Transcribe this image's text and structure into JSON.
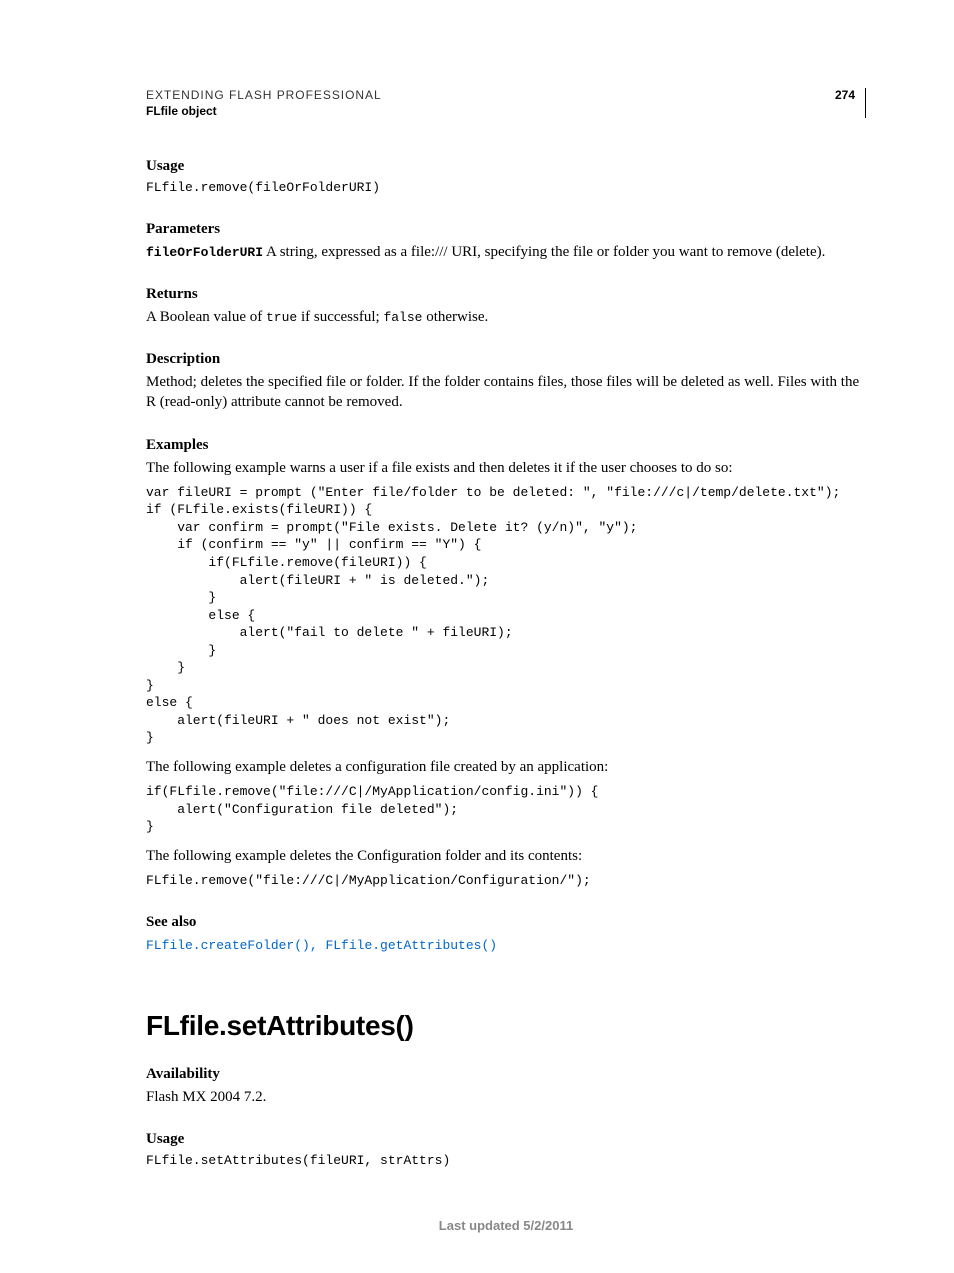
{
  "header": {
    "book_title": "EXTENDING FLASH PROFESSIONAL",
    "chapter_title": "FLfile object",
    "page_number": "274"
  },
  "sections": {
    "usage1": {
      "heading": "Usage",
      "code": "FLfile.remove(fileOrFolderURI)"
    },
    "parameters": {
      "heading": "Parameters",
      "param_name": "fileOrFolderURI",
      "param_desc": "  A string, expressed as a file:/// URI, specifying the file or folder you want to remove (delete)."
    },
    "returns": {
      "heading": "Returns",
      "text_a": "A Boolean value of ",
      "true": "true",
      "text_b": " if successful; ",
      "false": "false",
      "text_c": " otherwise."
    },
    "description": {
      "heading": "Description",
      "text": "Method; deletes the specified file or folder. If the folder contains files, those files will be deleted as well. Files with the R (read-only) attribute cannot be removed."
    },
    "examples": {
      "heading": "Examples",
      "intro1": "The following example warns a user if a file exists and then deletes it if the user chooses to do so:",
      "code1": "var fileURI = prompt (\"Enter file/folder to be deleted: \", \"file:///c|/temp/delete.txt\"); \nif (FLfile.exists(fileURI)) { \n    var confirm = prompt(\"File exists. Delete it? (y/n)\", \"y\"); \n    if (confirm == \"y\" || confirm == \"Y\") { \n        if(FLfile.remove(fileURI)) { \n            alert(fileURI + \" is deleted.\"); \n        } \n        else { \n            alert(\"fail to delete \" + fileURI); \n        } \n    } \n} \nelse { \n    alert(fileURI + \" does not exist\"); \n}",
      "intro2": "The following example deletes a configuration file created by an application:",
      "code2": "if(FLfile.remove(\"file:///C|/MyApplication/config.ini\")) { \n    alert(\"Configuration file deleted\"); \n}",
      "intro3": "The following example deletes the Configuration folder and its contents:",
      "code3": "FLfile.remove(\"file:///C|/MyApplication/Configuration/\");"
    },
    "seealso": {
      "heading": "See also",
      "link1": "FLfile.createFolder()",
      "sep": ", ",
      "link2": "FLfile.getAttributes()"
    }
  },
  "method2": {
    "title": "FLfile.setAttributes()",
    "availability": {
      "heading": "Availability",
      "text": "Flash MX 2004 7.2."
    },
    "usage": {
      "heading": "Usage",
      "code": "FLfile.setAttributes(fileURI, strAttrs)"
    }
  },
  "footer": "Last updated 5/2/2011"
}
